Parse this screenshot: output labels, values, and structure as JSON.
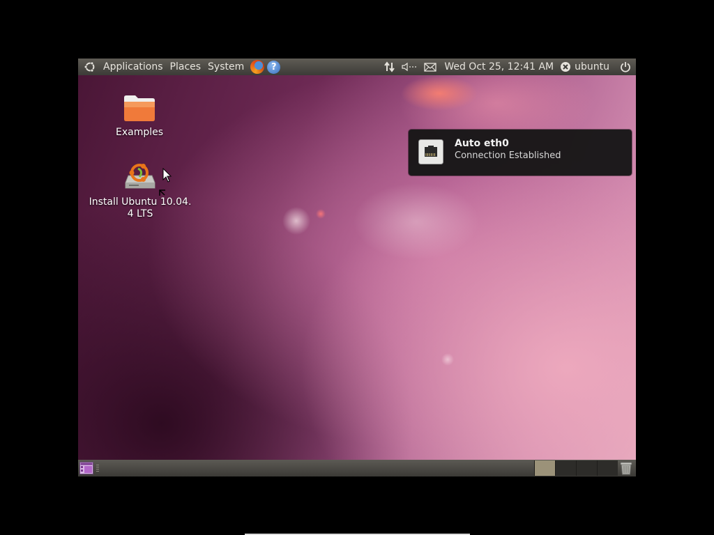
{
  "top_panel": {
    "menus": [
      "Applications",
      "Places",
      "System"
    ],
    "clock": "Wed Oct 25, 12:41 AM",
    "user": "ubuntu",
    "icons": [
      "ubuntu-logo-icon",
      "firefox-icon",
      "help-icon",
      "network-icon",
      "volume-icon",
      "mail-icon",
      "user-status-icon",
      "power-icon"
    ]
  },
  "desktop": {
    "icons": [
      {
        "label": "Examples",
        "icon": "folder-icon"
      },
      {
        "label": "Install Ubuntu 10.04.\n4 LTS",
        "icon": "installer-icon"
      }
    ]
  },
  "notification": {
    "title": "Auto eth0",
    "body": "Connection Established",
    "icon": "ethernet-icon"
  },
  "bottom_panel": {
    "icons": [
      "show-desktop-icon",
      "trash-icon"
    ],
    "workspaces": 4,
    "active_workspace": 1
  },
  "colors": {
    "panel": "#3c3b37",
    "notification_bg": "#161616",
    "wallpaper_dark": "#4a1636",
    "wallpaper_light": "#e2a7bd"
  }
}
